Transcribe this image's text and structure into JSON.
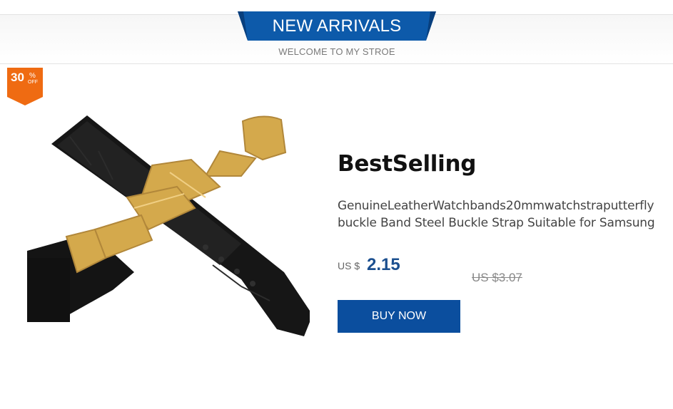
{
  "header": {
    "title": "NEW ARRIVALS",
    "subtitle": "WELCOME TO MY STROE"
  },
  "badge": {
    "number": "30",
    "percent": "%",
    "off": "OFF",
    "color": "#ef6b12"
  },
  "product": {
    "image_icon": "leather-watch-strap-image",
    "heading": "BestSelling",
    "description_line1": "GenuineLeatherWatchbands20mmwatchstraputterfly",
    "description_line2": "buckle Band Steel Buckle Strap Suitable for Samsung",
    "price_currency": "US $",
    "price": "2.15",
    "old_price": "US $3.07",
    "buy_label": "BUY NOW"
  },
  "colors": {
    "accent_blue": "#0b4e9e",
    "price_blue": "#1b4f8f"
  }
}
